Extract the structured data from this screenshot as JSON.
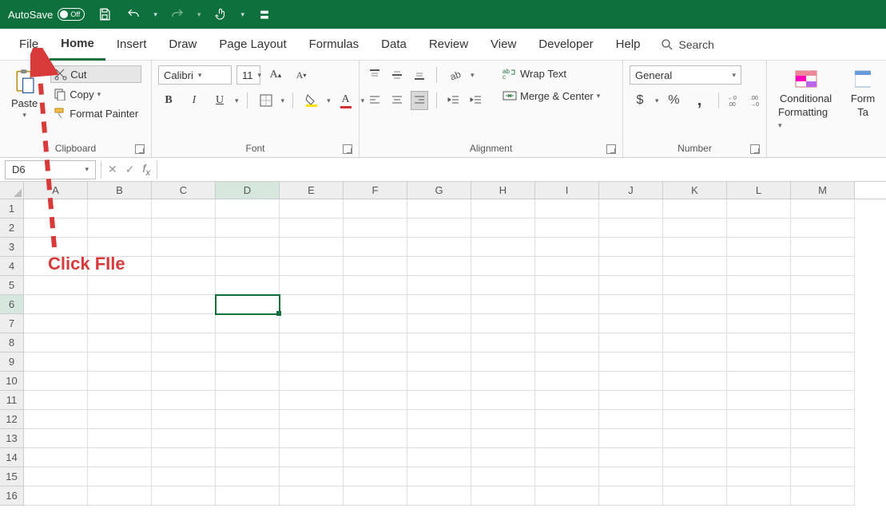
{
  "title_bar": {
    "autosave_label": "AutoSave",
    "autosave_state": "Off"
  },
  "menu": {
    "tabs": [
      "File",
      "Home",
      "Insert",
      "Draw",
      "Page Layout",
      "Formulas",
      "Data",
      "Review",
      "View",
      "Developer",
      "Help"
    ],
    "active": "Home",
    "search_label": "Search"
  },
  "ribbon": {
    "clipboard": {
      "paste": "Paste",
      "cut": "Cut",
      "copy": "Copy",
      "format_painter": "Format Painter",
      "label": "Clipboard"
    },
    "font": {
      "name": "Calibri",
      "size": "11",
      "label": "Font"
    },
    "alignment": {
      "wrap_text": "Wrap Text",
      "merge_center": "Merge & Center",
      "label": "Alignment"
    },
    "number": {
      "format": "General",
      "label": "Number"
    },
    "styles": {
      "conditional_formatting_l1": "Conditional",
      "conditional_formatting_l2": "Formatting",
      "format_table_l1": "Form",
      "format_table_l2": "Ta"
    }
  },
  "formula_bar": {
    "name_box": "D6",
    "formula": ""
  },
  "grid": {
    "columns": [
      "A",
      "B",
      "C",
      "D",
      "E",
      "F",
      "G",
      "H",
      "I",
      "J",
      "K",
      "L",
      "M"
    ],
    "row_count": 16,
    "selected_col": "D",
    "selected_row": 6
  },
  "annotation": {
    "text": "Click FIle"
  }
}
